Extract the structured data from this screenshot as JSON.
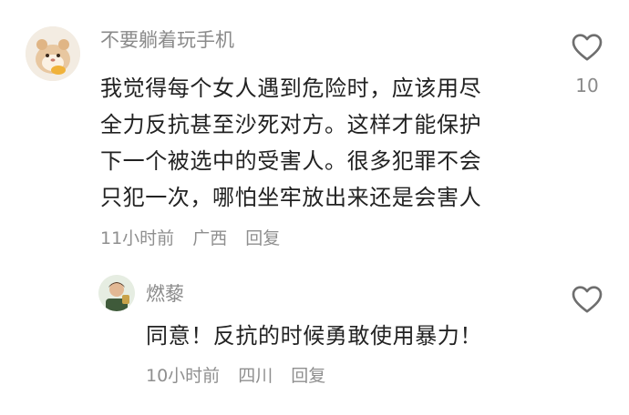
{
  "comment": {
    "username": "不要躺着玩手机",
    "lines": [
      "我觉得每个女人遇到危险时，应该用尽",
      "全力反抗甚至沙死对方。这样才能保护",
      "下一个被选中的受害人。很多犯罪不会",
      "只犯一次，哪怕坐牢放出来还是会害人"
    ],
    "time": "11小时前",
    "location": "广西",
    "reply_label": "回复",
    "like_count": "10"
  },
  "reply": {
    "username": "燃藜",
    "text": "同意！反抗的时候勇敢使用暴力！",
    "time": "10小时前",
    "location": "四川",
    "reply_label": "回复"
  },
  "icons": {
    "like": "heart-outline-icon"
  },
  "colors": {
    "text": "#222222",
    "secondary": "#8a8a8a",
    "background": "#ffffff"
  }
}
